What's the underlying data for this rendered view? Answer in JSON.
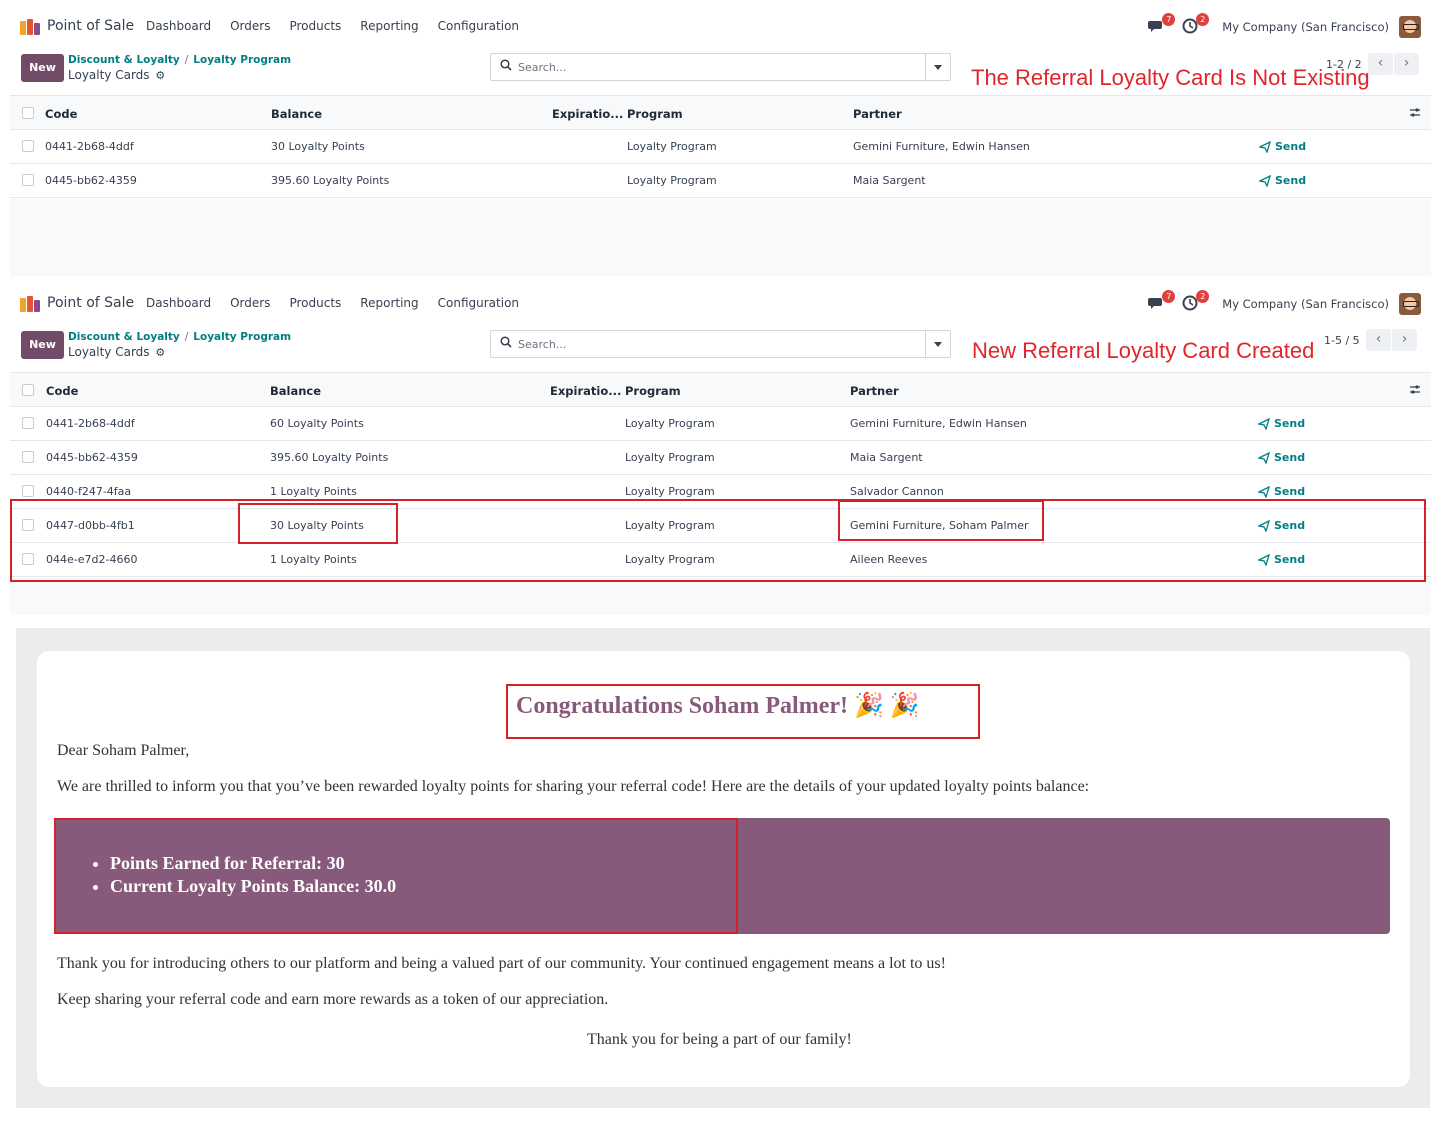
{
  "app": {
    "name": "Point of Sale",
    "menu": [
      "Dashboard",
      "Orders",
      "Products",
      "Reporting",
      "Configuration"
    ],
    "company": "My Company (San Francisco)",
    "badges": {
      "messages": "7",
      "activities": "2"
    },
    "logo_colors": [
      "#f0a32b",
      "#e5562f",
      "#8b4a8b"
    ]
  },
  "controls": {
    "new_label": "New",
    "breadcrumb": [
      "Discount & Loyalty",
      "Loyalty Program"
    ],
    "page_title": "Loyalty Cards",
    "search_placeholder": "Search..."
  },
  "columns": [
    "Code",
    "Balance",
    "Expiratio...",
    "Program",
    "Partner"
  ],
  "send_label": "Send",
  "before": {
    "annotation": "The Referral Loyalty Card Is Not Existing",
    "pager": "1-2 / 2",
    "rows": [
      {
        "code": "0441-2b68-4ddf",
        "balance": "30 Loyalty Points",
        "program": "Loyalty Program",
        "partner": "Gemini Furniture, Edwin Hansen"
      },
      {
        "code": "0445-bb62-4359",
        "balance": "395.60 Loyalty Points",
        "program": "Loyalty Program",
        "partner": "Maia Sargent"
      }
    ]
  },
  "after": {
    "annotation": "New Referral Loyalty Card Created",
    "pager": "1-5 / 5",
    "rows": [
      {
        "code": "0441-2b68-4ddf",
        "balance": "60 Loyalty Points",
        "program": "Loyalty Program",
        "partner": "Gemini Furniture, Edwin Hansen"
      },
      {
        "code": "0445-bb62-4359",
        "balance": "395.60 Loyalty Points",
        "program": "Loyalty Program",
        "partner": "Maia Sargent"
      },
      {
        "code": "0440-f247-4faa",
        "balance": "1 Loyalty Points",
        "program": "Loyalty Program",
        "partner": "Salvador Cannon"
      },
      {
        "code": "0447-d0bb-4fb1",
        "balance": "30 Loyalty Points",
        "program": "Loyalty Program",
        "partner": "Gemini Furniture, Soham Palmer"
      },
      {
        "code": "044e-e7d2-4660",
        "balance": "1 Loyalty Points",
        "program": "Loyalty Program",
        "partner": "Aileen Reeves"
      }
    ]
  },
  "email": {
    "title": "Congratulations Soham Palmer! 🎉 🎉",
    "greeting": "Dear Soham Palmer,",
    "intro": "We are thrilled to inform you that you’ve been rewarded loyalty points for sharing your referral code! Here are the details of your updated loyalty points balance:",
    "points_earned": "Points Earned for Referral: 30",
    "balance": "Current Loyalty Points Balance: 30.0",
    "thanks_intro": "Thank you for introducing others to our platform and being a valued part of our community. Your continued engagement means a lot to us!",
    "keep_sharing": "Keep sharing your referral code and earn more rewards as a token of our appreciation.",
    "closing": "Thank you for being a part of our family!"
  }
}
